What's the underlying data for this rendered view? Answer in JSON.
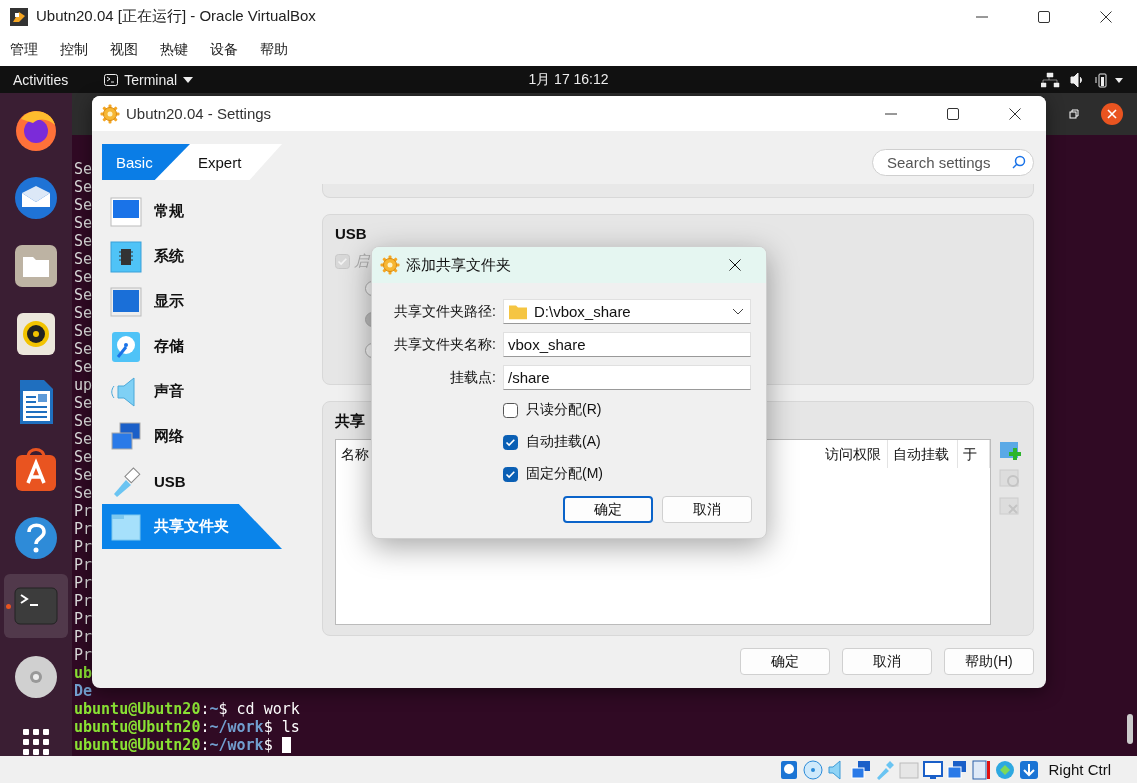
{
  "host_window": {
    "title": "Ubutn20.04 [正在运行] - Oracle VirtualBox",
    "menu": [
      "管理",
      "控制",
      "视图",
      "热键",
      "设备",
      "帮助"
    ]
  },
  "top_bar": {
    "activities": "Activities",
    "app_menu": "Terminal",
    "clock": "1月 17  16:12"
  },
  "dock": [
    {
      "kind": "browser",
      "selected": false
    },
    {
      "kind": "mail",
      "selected": false
    },
    {
      "kind": "files",
      "selected": false
    },
    {
      "kind": "music",
      "selected": false
    },
    {
      "kind": "writer",
      "selected": false
    },
    {
      "kind": "store",
      "selected": false
    },
    {
      "kind": "help",
      "selected": false
    },
    {
      "kind": "terminal",
      "selected": true
    },
    {
      "kind": "disc",
      "selected": false
    },
    {
      "kind": "apps",
      "selected": false
    }
  ],
  "terminal": {
    "lines": [
      {
        "kind": "plain",
        "text": "Se"
      },
      {
        "kind": "plain",
        "text": "Se"
      },
      {
        "kind": "plain",
        "text": "Se"
      },
      {
        "kind": "plain",
        "text": "Se"
      },
      {
        "kind": "plain",
        "text": "Se"
      },
      {
        "kind": "plain",
        "text": "Se"
      },
      {
        "kind": "plain",
        "text": "Se"
      },
      {
        "kind": "plain",
        "text": "Se"
      },
      {
        "kind": "plain",
        "text": "Se"
      },
      {
        "kind": "plain",
        "text": "Se"
      },
      {
        "kind": "plain",
        "text": "Se"
      },
      {
        "kind": "plain",
        "text": "Se"
      },
      {
        "kind": "plain",
        "text": "up"
      },
      {
        "kind": "plain",
        "text": "Se"
      },
      {
        "kind": "plain",
        "text": "Se"
      },
      {
        "kind": "plain",
        "text": "Se"
      },
      {
        "kind": "plain",
        "text": "Se"
      },
      {
        "kind": "plain",
        "text": "Se"
      },
      {
        "kind": "plain",
        "text": "Se"
      },
      {
        "kind": "plain",
        "text": "Pr"
      },
      {
        "kind": "plain",
        "text": "Pr"
      },
      {
        "kind": "plain",
        "text": "Pr"
      },
      {
        "kind": "plain",
        "text": "Pr"
      },
      {
        "kind": "plain",
        "text": "Pr"
      },
      {
        "kind": "plain",
        "text": "Pr"
      },
      {
        "kind": "plain",
        "text": "Pr"
      },
      {
        "kind": "plain",
        "text": "Pr"
      },
      {
        "kind": "plain",
        "text": "Pr"
      },
      {
        "kind": "user",
        "text": "ub"
      },
      {
        "kind": "info",
        "text": "De"
      },
      {
        "kind": "prompt",
        "user": "ubuntu@Ubutn20",
        "sep": ":",
        "path": "~",
        "command": "$ cd work",
        "cursor": false
      },
      {
        "kind": "prompt",
        "user": "ubuntu@Ubutn20",
        "sep": ":",
        "path": "~/work",
        "command": "$ ls",
        "cursor": false
      },
      {
        "kind": "prompt",
        "user": "ubuntu@Ubutn20",
        "sep": ":",
        "path": "~/work",
        "command": "$",
        "cursor": true
      }
    ]
  },
  "settings": {
    "title": "Ubutn20.04 - Settings",
    "modes": [
      {
        "label": "Basic",
        "selected": true
      },
      {
        "label": "Expert",
        "selected": false
      }
    ],
    "search": {
      "placeholder": "Search settings"
    },
    "sections": [
      {
        "kind": "general",
        "label": "常规",
        "selected": false
      },
      {
        "kind": "system",
        "label": "系统",
        "selected": false
      },
      {
        "kind": "display",
        "label": "显示",
        "selected": false
      },
      {
        "kind": "storage",
        "label": "存储",
        "selected": false
      },
      {
        "kind": "audio",
        "label": "声音",
        "selected": false
      },
      {
        "kind": "network",
        "label": "网络",
        "selected": false
      },
      {
        "kind": "usb",
        "label": "USB",
        "selected": false
      },
      {
        "kind": "shared",
        "label": "共享文件夹",
        "selected": true
      }
    ],
    "usb": {
      "title": "USB",
      "enable": {
        "label": "启",
        "checked": true,
        "disabled": true
      },
      "options": [
        {
          "selected": false
        },
        {
          "selected": true
        },
        {
          "selected": false
        }
      ]
    },
    "shared_folders": {
      "title": "共享",
      "columns": [
        "名称",
        "访问权限",
        "自动挂载",
        "于"
      ]
    },
    "buttons": [
      "确定",
      "取消",
      "帮助(H)"
    ]
  },
  "dialog": {
    "title": "添加共享文件夹",
    "fields": [
      {
        "kind": "combo",
        "label": "共享文件夹路径:",
        "value": "D:\\vbox_share"
      },
      {
        "kind": "text",
        "label": "共享文件夹名称:",
        "value": "vbox_share"
      },
      {
        "kind": "text",
        "label": "挂载点:",
        "value": "/share"
      }
    ],
    "options": [
      {
        "label": "只读分配(R)",
        "checked": false
      },
      {
        "label": "自动挂载(A)",
        "checked": true
      },
      {
        "label": "固定分配(M)",
        "checked": true
      }
    ],
    "buttons": [
      {
        "label": "确定",
        "selected": true
      },
      {
        "label": "取消",
        "selected": false
      }
    ]
  },
  "status_bar": {
    "host_key": "Right Ctrl"
  }
}
